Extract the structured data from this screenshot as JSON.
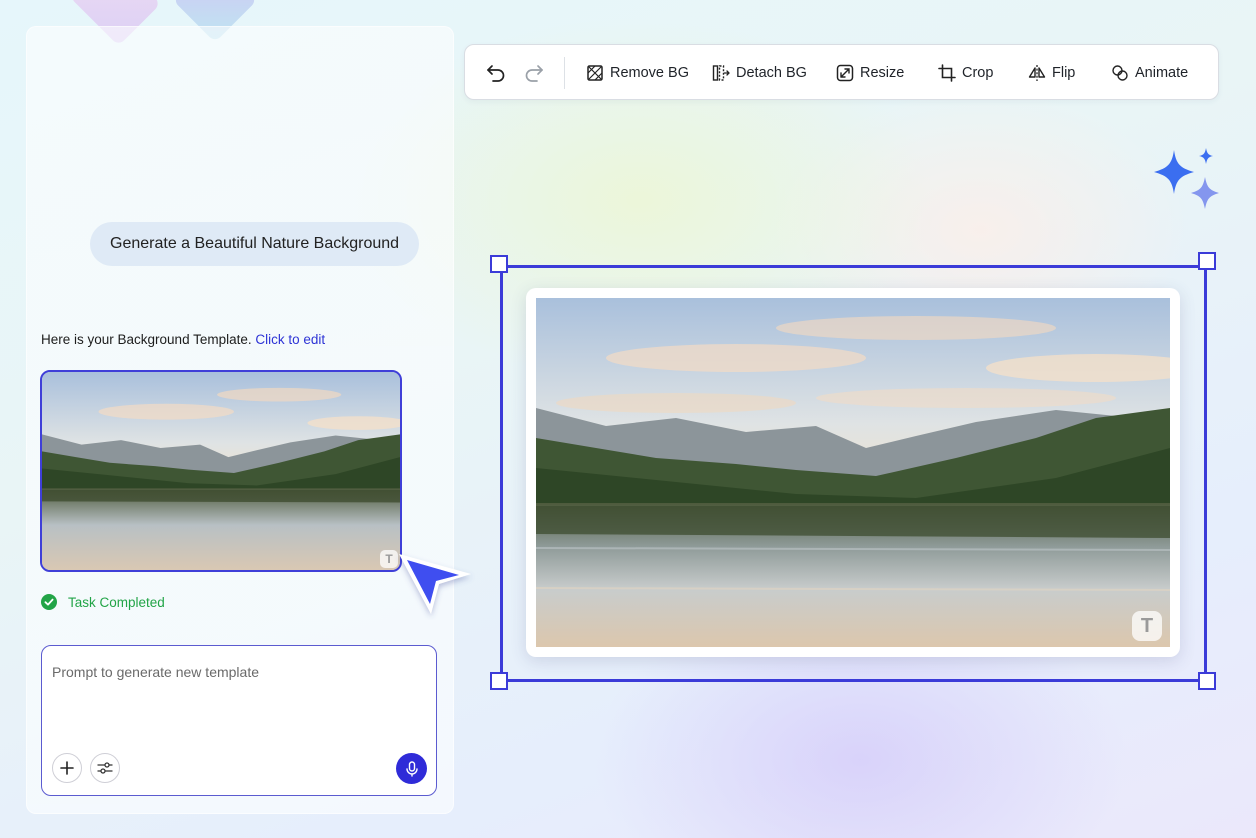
{
  "toolbar": {
    "undo_icon": "undo-icon",
    "redo_icon": "redo-icon",
    "buttons": [
      {
        "label": "Remove BG",
        "icon": "remove-bg-icon"
      },
      {
        "label": "Detach BG",
        "icon": "detach-bg-icon"
      },
      {
        "label": "Resize",
        "icon": "resize-icon"
      },
      {
        "label": "Crop",
        "icon": "crop-icon"
      },
      {
        "label": "Flip",
        "icon": "flip-icon"
      },
      {
        "label": "Animate",
        "icon": "animate-icon"
      }
    ]
  },
  "chat": {
    "user_message": "Generate a Beautiful Nature Background",
    "assistant_reply": "Here is your Background Template.",
    "edit_link": "Click to edit",
    "task_status": "Task Completed",
    "watermark": "T"
  },
  "prompt": {
    "placeholder": "Prompt to generate new template",
    "value": ""
  },
  "canvas": {
    "image": "mountain-lake-landscape",
    "watermark": "T"
  },
  "colors": {
    "accent": "#3b3bd8",
    "mic_button": "#2f2bd8",
    "success": "#22a447",
    "link": "#2e34d6",
    "sparkle": "#3b6ef0"
  }
}
